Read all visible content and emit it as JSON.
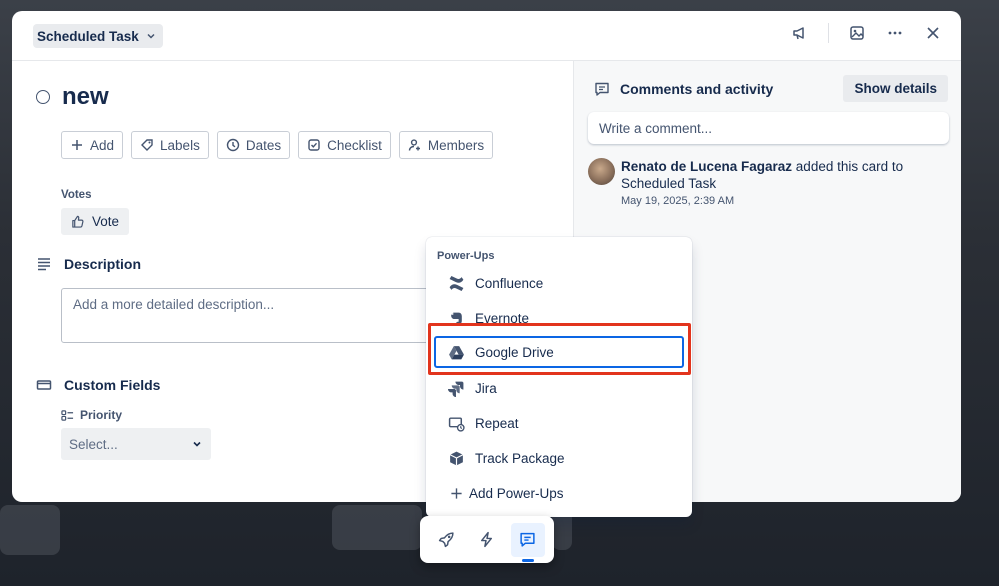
{
  "header": {
    "list_name": "Scheduled Task"
  },
  "card": {
    "title": "new",
    "actions": [
      "Add",
      "Labels",
      "Dates",
      "Checklist",
      "Members"
    ],
    "votes_label": "Votes",
    "vote_button": "Vote",
    "description_heading": "Description",
    "description_placeholder": "Add a more detailed description...",
    "custom_fields_heading": "Custom Fields",
    "priority_label": "Priority",
    "priority_select": "Select..."
  },
  "sidebar": {
    "comments_heading": "Comments and activity",
    "show_details": "Show details",
    "comment_placeholder": "Write a comment...",
    "activity": {
      "user": "Renato de Lucena Fagaraz",
      "action": " added this card to Scheduled Task",
      "time": "May 19, 2025, 2:39 AM"
    }
  },
  "powerups": {
    "title": "Power-Ups",
    "items": [
      "Confluence",
      "Evernote",
      "Google Drive",
      "Jira",
      "Repeat",
      "Track Package"
    ],
    "selected": "Google Drive",
    "add_label": "Add Power-Ups"
  },
  "colors": {
    "accent": "#0c66e4",
    "highlight": "#e2341d"
  }
}
